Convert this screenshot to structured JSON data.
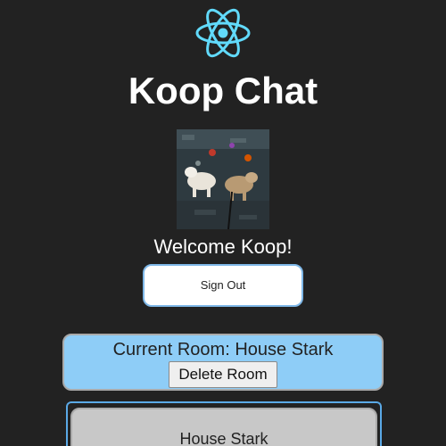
{
  "header": {
    "logo_icon": "react-atom-icon",
    "logo_color": "#61dafb",
    "title": "Koop Chat"
  },
  "user": {
    "avatar_icon": "user-photo-dogs",
    "welcome_text": "Welcome Koop!"
  },
  "auth": {
    "sign_out_label": "Sign Out"
  },
  "current_room": {
    "title": "Current Room: House Stark",
    "delete_label": "Delete Room",
    "background": "#8ecdf7"
  },
  "rooms": {
    "items": [
      {
        "label": "House Stark"
      }
    ]
  }
}
